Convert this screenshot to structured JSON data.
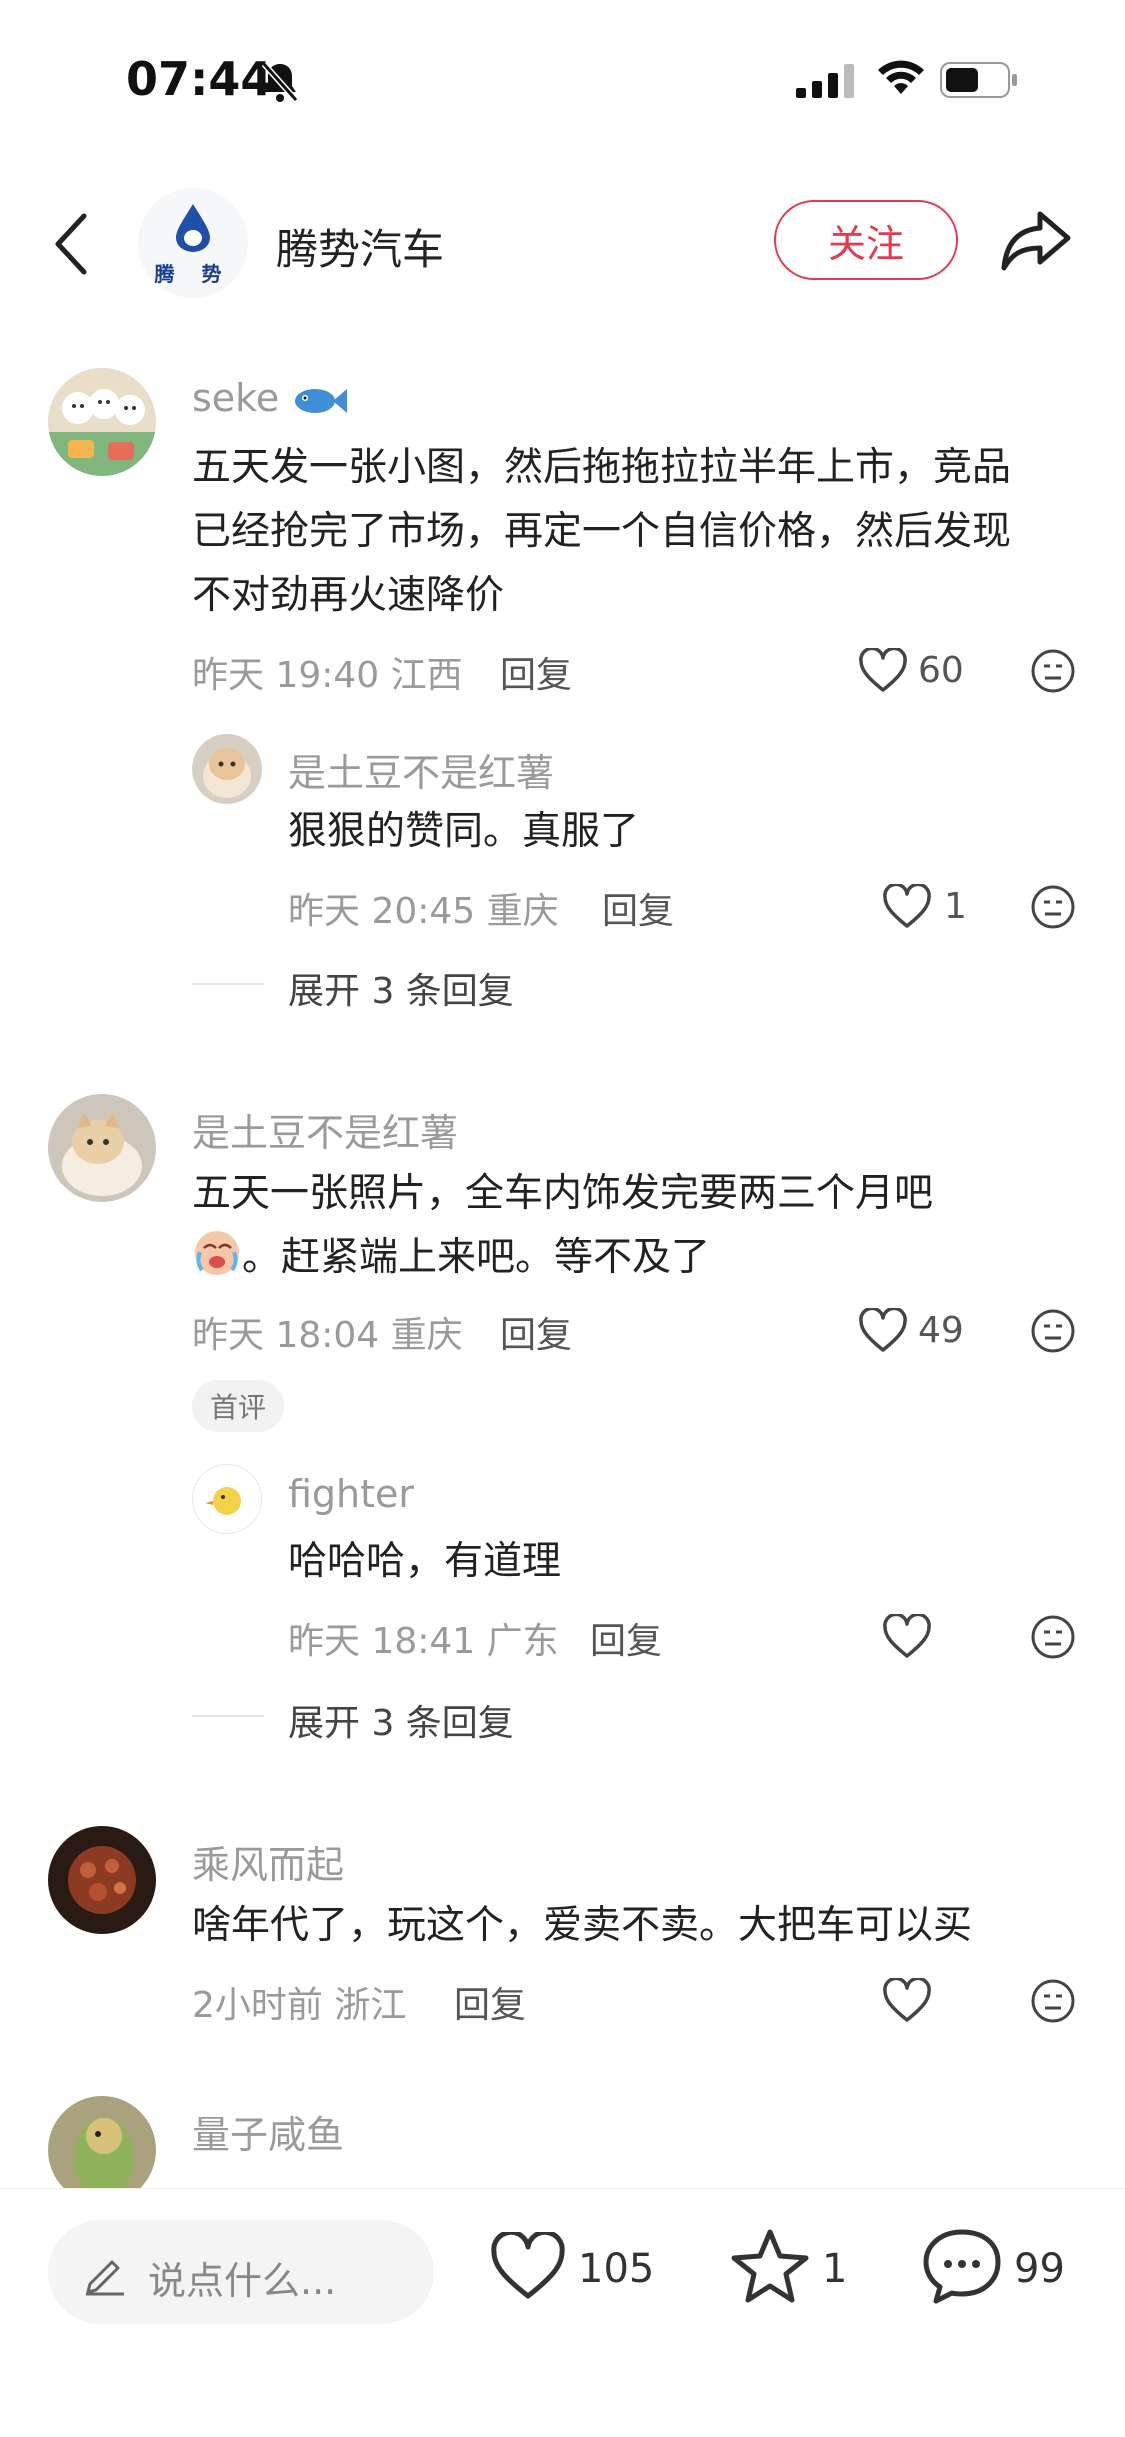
{
  "status_bar": {
    "time": "07:44"
  },
  "header": {
    "account_name": "腾势汽车",
    "logo_text": "腾 势",
    "follow_label": "关注"
  },
  "comments": [
    {
      "username": "seke",
      "text_lines": [
        "五天发一张小图，然后拖拖拉拉半年上市，竞品",
        "已经抢完了市场，再定一个自信价格，然后发现",
        "不对劲再火速降价"
      ],
      "meta": "昨天 19:40 江西",
      "reply_label": "回复",
      "likes": "60",
      "replies": [
        {
          "username": "是土豆不是红薯",
          "text": "狠狠的赞同。真服了",
          "meta": "昨天 20:45 重庆",
          "reply_label": "回复",
          "likes": "1"
        }
      ],
      "expand_label": "展开 3 条回复"
    },
    {
      "username": "是土豆不是红薯",
      "text_lines": [
        "五天一张照片，全车内饰发完要两三个月吧",
        "。赶紧端上来吧。等不及了"
      ],
      "meta": "昨天 18:04 重庆",
      "reply_label": "回复",
      "likes": "49",
      "badge": "首评",
      "replies": [
        {
          "username": "fighter",
          "text": "哈哈哈，有道理",
          "meta": "昨天 18:41 广东",
          "reply_label": "回复",
          "likes": ""
        }
      ],
      "expand_label": "展开 3 条回复"
    },
    {
      "username": "乘风而起",
      "text_lines": [
        "啥年代了，玩这个，爱卖不卖。大把车可以买"
      ],
      "meta": "2小时前 浙江",
      "reply_label": "回复",
      "likes": ""
    },
    {
      "username": "量子咸鱼"
    }
  ],
  "bottom_bar": {
    "input_placeholder": "说点什么...",
    "like_count": "105",
    "fav_count": "1",
    "comment_count": "99"
  },
  "colors": {
    "accent": "#e8384f",
    "muted": "#9a9a9a"
  }
}
